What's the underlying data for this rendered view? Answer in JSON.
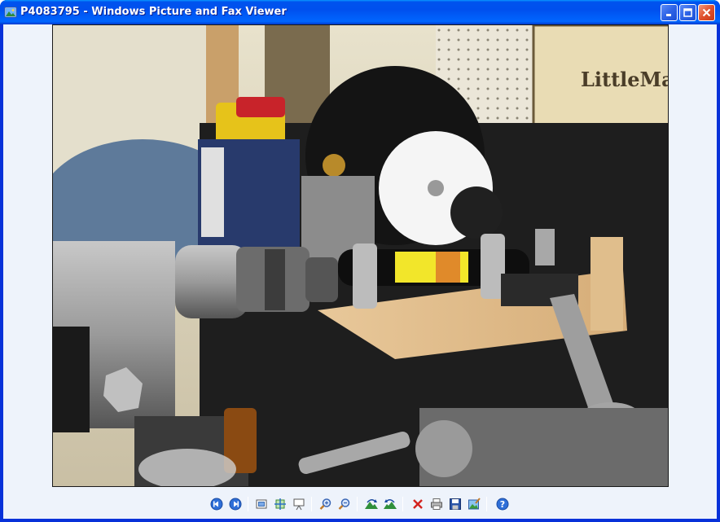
{
  "window": {
    "title": "P4083795 - Windows Picture and Fax Viewer",
    "app_icon": "picture-viewer-icon",
    "controls": [
      "minimize-icon",
      "maximize-icon",
      "close-icon"
    ]
  },
  "image": {
    "description_icon": "photo",
    "sign_text": "LittleMac"
  },
  "toolbar": {
    "buttons": [
      {
        "name": "previous-image-button",
        "icon": "previous-icon"
      },
      {
        "name": "next-image-button",
        "icon": "next-icon"
      },
      {
        "name": "best-fit-button",
        "icon": "best-fit-icon"
      },
      {
        "name": "actual-size-button",
        "icon": "actual-size-icon"
      },
      {
        "name": "slideshow-button",
        "icon": "slideshow-icon"
      },
      {
        "name": "zoom-in-button",
        "icon": "zoom-in-icon"
      },
      {
        "name": "zoom-out-button",
        "icon": "zoom-out-icon"
      },
      {
        "name": "rotate-clockwise-button",
        "icon": "rotate-clockwise-icon"
      },
      {
        "name": "rotate-counterclockwise-button",
        "icon": "rotate-counterclockwise-icon"
      },
      {
        "name": "delete-button",
        "icon": "delete-icon"
      },
      {
        "name": "print-button",
        "icon": "print-icon"
      },
      {
        "name": "save-button",
        "icon": "save-icon"
      },
      {
        "name": "edit-button",
        "icon": "edit-icon"
      },
      {
        "name": "help-button",
        "icon": "help-icon"
      }
    ]
  },
  "colors": {
    "titlebar": "#0054e3",
    "client_bg": "#eef3fb",
    "close_button": "#e0512e"
  }
}
